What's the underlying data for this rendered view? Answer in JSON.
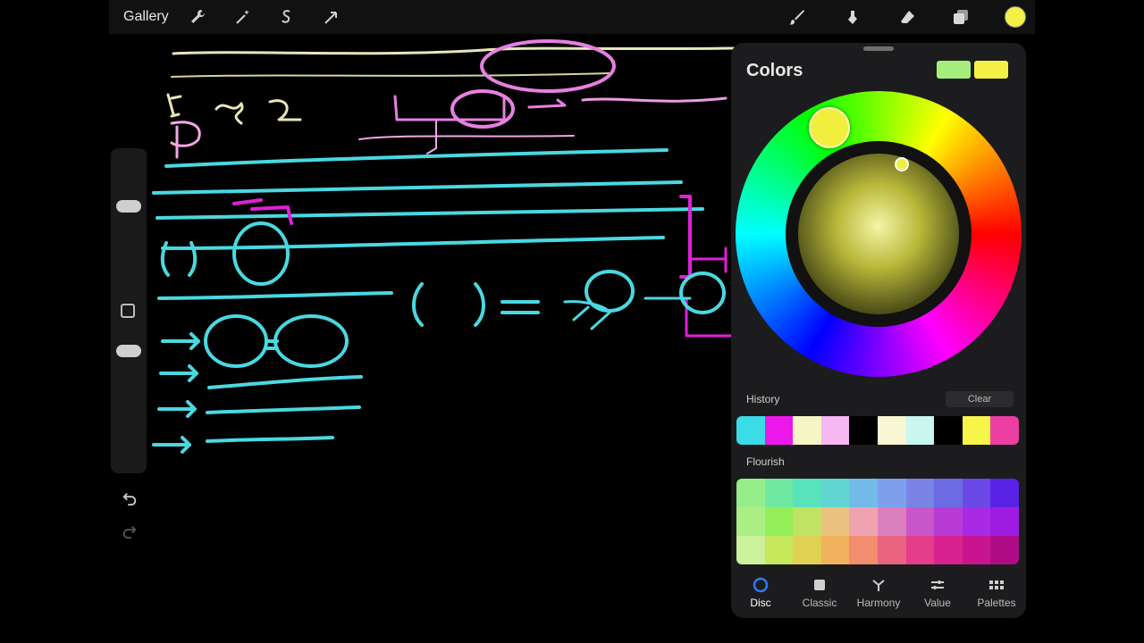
{
  "topbar": {
    "gallery_label": "Gallery",
    "left_tools": [
      "wrench-icon",
      "magic-wand-icon",
      "selection-icon",
      "transform-icon"
    ],
    "right_tools": [
      "brush-icon",
      "smudge-icon",
      "eraser-icon",
      "layers-icon"
    ],
    "current_color": "#f4f046"
  },
  "colors_panel": {
    "title": "Colors",
    "primary_swatch": "#a6ee7b",
    "secondary_swatch": "#f4f046",
    "history_label": "History",
    "clear_label": "Clear",
    "history": [
      "#3bdbe8",
      "#ec17ea",
      "#f6f5c5",
      "#f6b7f3",
      "#000000",
      "#f8f6d3",
      "#c9f6ef",
      "#000000",
      "#f7f54a",
      "#ed3ea4"
    ],
    "palette_label": "Flourish",
    "palette": [
      "#96ee8a",
      "#6fe8a1",
      "#59e3bb",
      "#62d6d3",
      "#73bbe9",
      "#7ea0ec",
      "#7a84e7",
      "#6c6be4",
      "#6b49e6",
      "#5822e6",
      "#a9ef84",
      "#94f058",
      "#c0e365",
      "#ebc27d",
      "#efa3b0",
      "#dc7fbf",
      "#c856c8",
      "#b83bd5",
      "#a92ae4",
      "#9e1ce2",
      "#cbf19a",
      "#c5e85c",
      "#e0d152",
      "#f0b25c",
      "#f08e6e",
      "#ea6482",
      "#e33d8c",
      "#d9228f",
      "#c8158f",
      "#ae0c87"
    ],
    "tabs": [
      {
        "label": "Disc",
        "icon": "disc-icon",
        "active": true
      },
      {
        "label": "Classic",
        "icon": "classic-icon",
        "active": false
      },
      {
        "label": "Harmony",
        "icon": "harmony-icon",
        "active": false
      },
      {
        "label": "Value",
        "icon": "sliders-icon",
        "active": false
      },
      {
        "label": "Palettes",
        "icon": "palettes-icon",
        "active": false
      }
    ]
  }
}
